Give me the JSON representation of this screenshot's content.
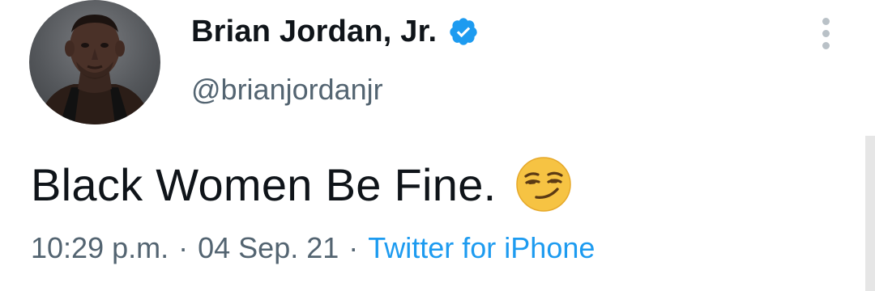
{
  "tweet": {
    "author": {
      "display_name": "Brian Jordan, Jr.",
      "handle": "@brianjordanjr",
      "verified": true,
      "avatar_icon": "profile-photo"
    },
    "text": "Black Women Be Fine.",
    "emoji": "smirking-face-emoji",
    "meta": {
      "time": "10:29 p.m.",
      "separator": "·",
      "date": "04 Sep. 21",
      "source": "Twitter for iPhone"
    },
    "menu_icon": "more-vertical-icon"
  },
  "colors": {
    "text_primary": "#0f1419",
    "text_secondary": "#536471",
    "accent": "#1d9bf0",
    "emoji_yellow": "#f6c343"
  }
}
